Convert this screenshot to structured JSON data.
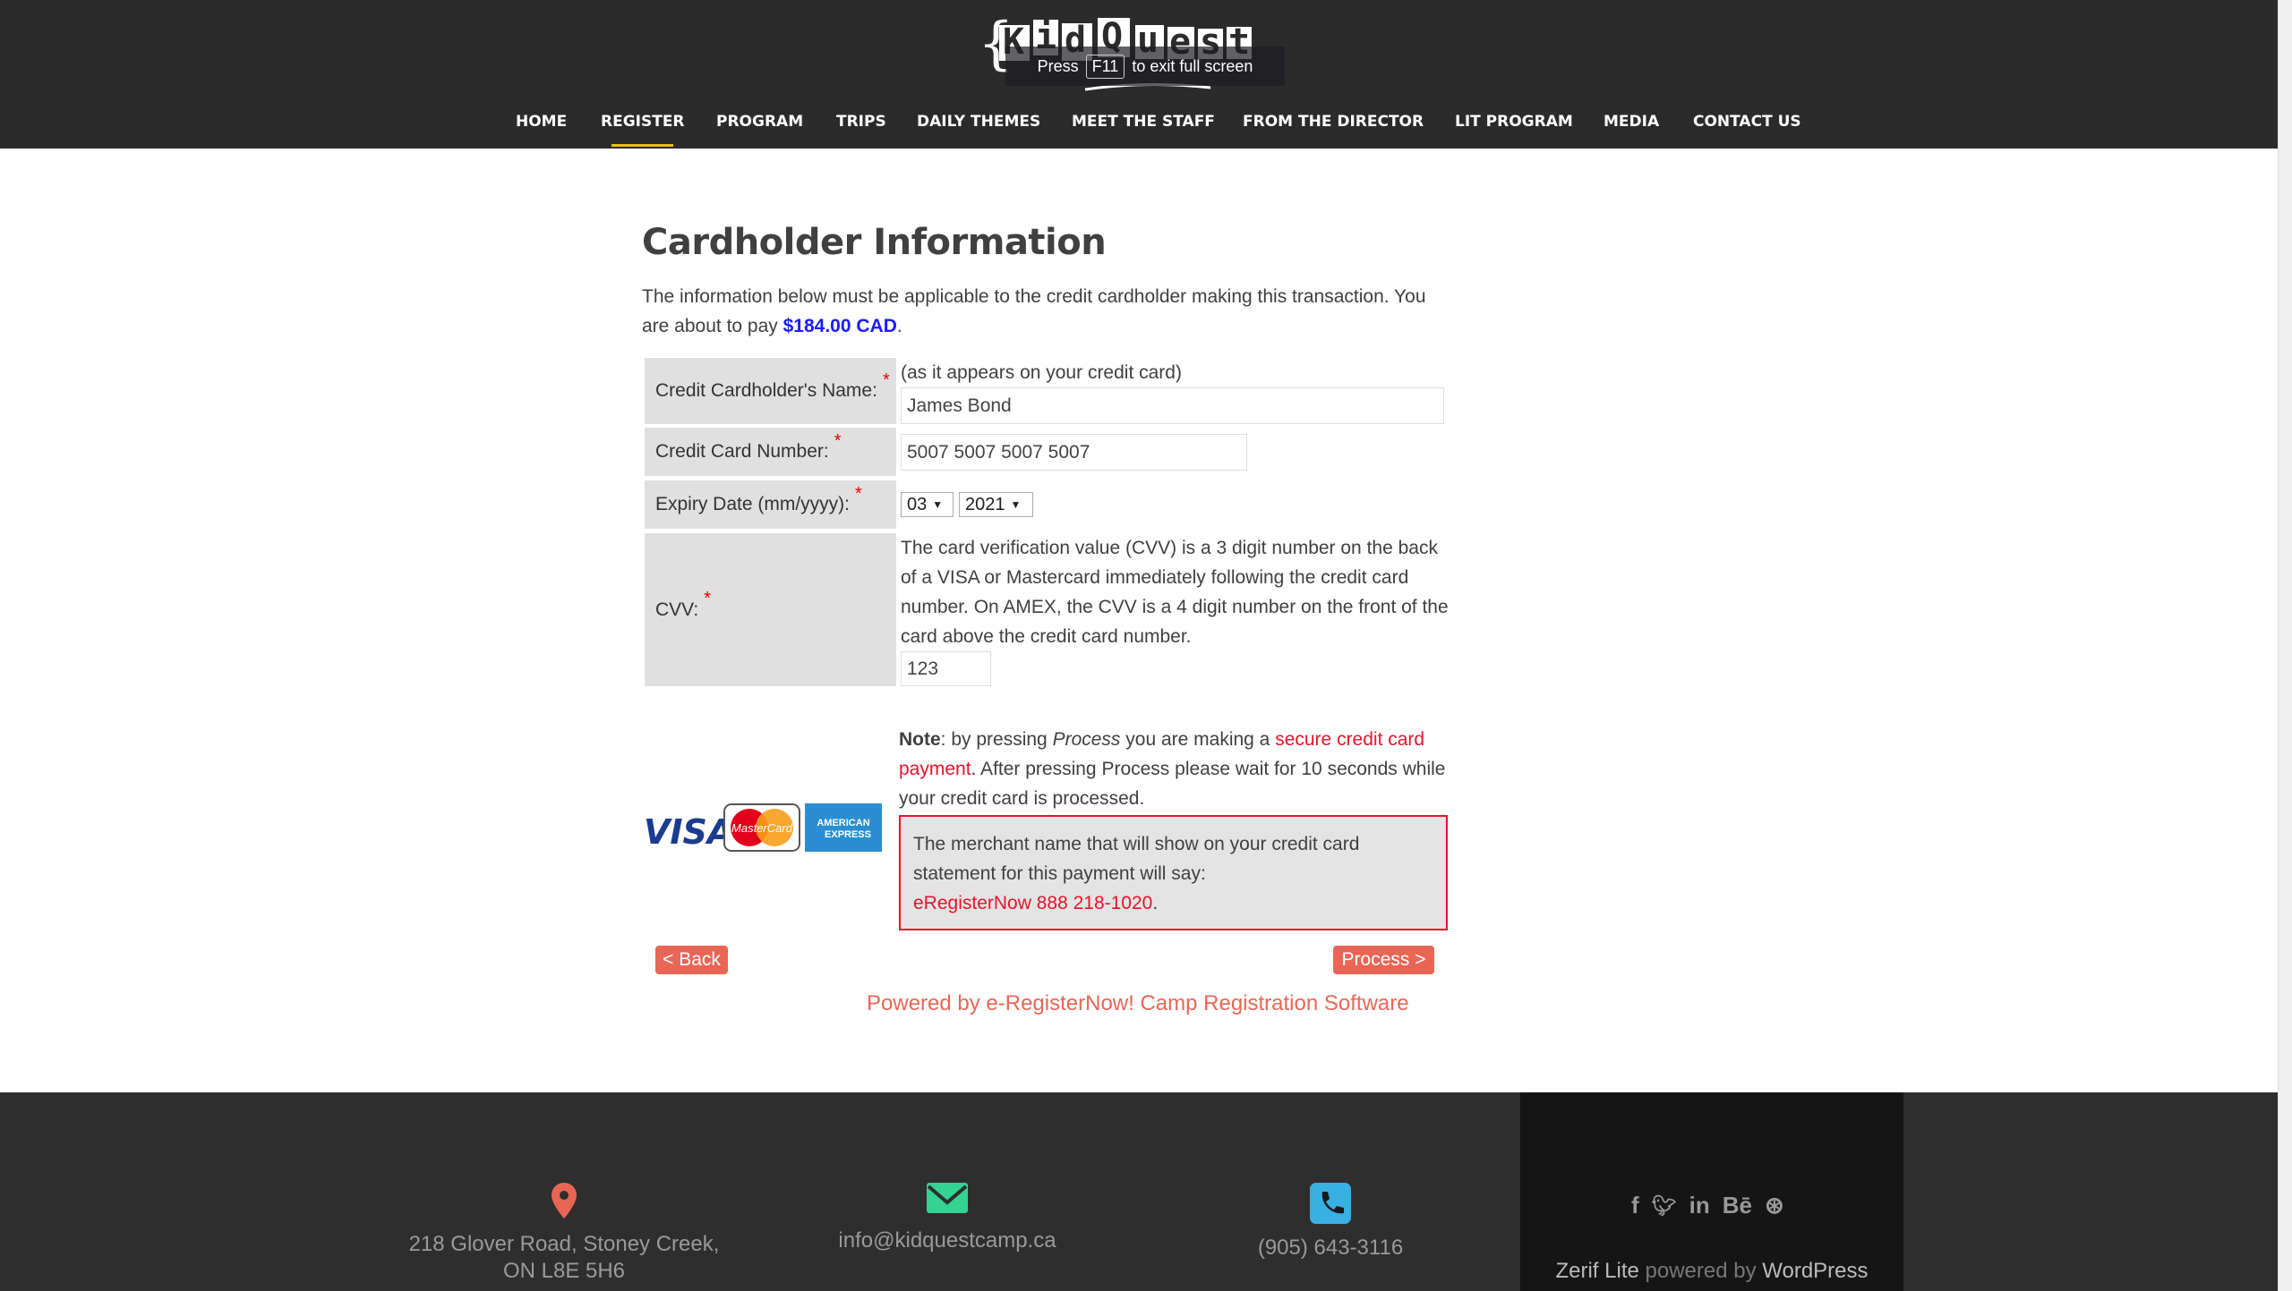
{
  "header": {
    "logo_text": "KidQuest Camp",
    "fullscreen_hint": {
      "prefix": "Press",
      "key": "F11",
      "suffix": "to exit full screen"
    },
    "nav": [
      {
        "label": "HOME"
      },
      {
        "label": "REGISTER",
        "active": true
      },
      {
        "label": "PROGRAM"
      },
      {
        "label": "TRIPS"
      },
      {
        "label": "DAILY THEMES"
      },
      {
        "label": "MEET THE STAFF"
      },
      {
        "label": "FROM THE DIRECTOR"
      },
      {
        "label": "LIT PROGRAM"
      },
      {
        "label": "MEDIA"
      },
      {
        "label": "CONTACT US"
      }
    ],
    "accent": "#e8c10e"
  },
  "main": {
    "title": "Cardholder Information",
    "intro": "The information below must be applicable to the credit cardholder making this transaction. You are about to pay ",
    "amount": "$184.00 CAD",
    "intro_end": ".",
    "form": {
      "name_label": "Credit Cardholder's Name:",
      "name_hint": "(as it appears on your credit card)",
      "name_value": "James Bond",
      "number_label": "Credit Card Number:",
      "number_value": "5007 5007 5007 5007",
      "expiry_label": "Expiry Date (mm/yyyy):",
      "expiry_month": "03",
      "expiry_year": "2021",
      "cvv_label": "CVV:",
      "cvv_help": "The card verification value (CVV) is a 3 digit number on the back of a VISA or Mastercard immediately following the credit card number. On AMEX, the CVV is a 4 digit number on the front of the card above the credit card number.",
      "cvv_value": "123",
      "required_mark": "*"
    },
    "cards": {
      "visa": "VISA",
      "mastercard": "MasterCard",
      "amex": "AMERICAN EXPRESS"
    },
    "note": {
      "bold": "Note",
      "t1": ": by pressing ",
      "process_word": "Process",
      "t2": " you are making a ",
      "link": "secure credit card payment",
      "t3": ". After pressing Process please wait for 10 seconds while your credit card is processed."
    },
    "merchant": {
      "text": "The merchant name that will show on your credit card statement for this payment will say:",
      "name": "eRegisterNow 888 218-1020",
      "end": "."
    },
    "back_label": "< Back",
    "process_label": "Process >",
    "powered": "Powered by e-RegisterNow! Camp Registration Software"
  },
  "footer": {
    "address": [
      "218 Glover Road, Stoney Creek,",
      "ON L8E 5H6"
    ],
    "email": "info@kidquestcamp.ca",
    "phone": "(905) 643-3116",
    "social": [
      "facebook-icon",
      "twitter-icon",
      "linkedin-icon",
      "behance-icon",
      "dribbble-icon"
    ],
    "credit": {
      "theme": "Zerif Lite",
      "mid": " powered by ",
      "wp": "WordPress"
    },
    "colors": {
      "location": "#e96656",
      "email": "#34d293",
      "phone": "#3ab0e2"
    }
  }
}
